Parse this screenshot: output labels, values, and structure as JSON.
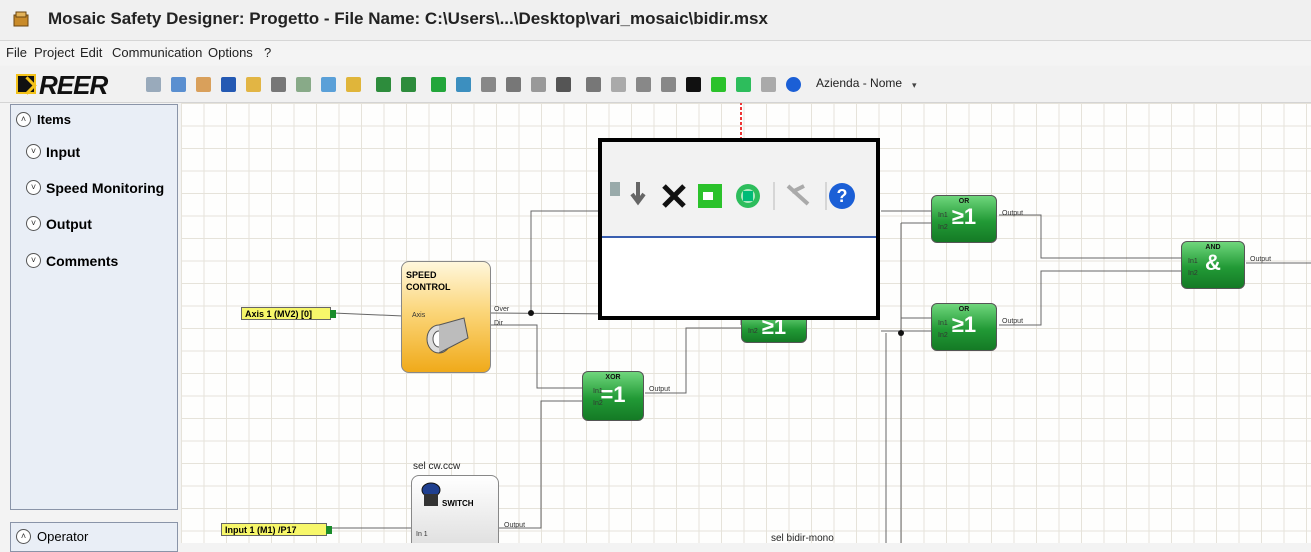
{
  "window": {
    "title": "Mosaic Safety Designer: Progetto  -  File Name: C:\\Users\\...\\Desktop\\vari_mosaic\\bidir.msx"
  },
  "menu": [
    "File",
    "Project",
    "Edit",
    "Communication",
    "Options",
    "?"
  ],
  "toolbar": {
    "logo": "REER",
    "company": "Azienda - Nome",
    "icons": [
      "new-project-icon",
      "open-icon",
      "user-icon",
      "save-icon",
      "folder-icon",
      "print-icon",
      "print-preview-icon",
      "report-icon",
      "pencil-icon",
      "undo-icon",
      "redo-icon",
      "validate-check-icon",
      "compile-icon",
      "connect-icon",
      "monitor-icon",
      "password-icon",
      "upload-icon",
      "zoom-icon",
      "clipboard-icon",
      "download-icon",
      "disconnect-icon",
      "delete-icon",
      "io-test-icon",
      "tool-icon",
      "pin-icon",
      "help-icon"
    ]
  },
  "left_panel": {
    "items_header": "Items",
    "sections": [
      "Input",
      "Speed Monitoring",
      "Output",
      "Comments"
    ],
    "operator_header": "Operator"
  },
  "canvas": {
    "inputs": [
      {
        "label": "Axis 1 (MV2) [0]"
      },
      {
        "label": "Input 1 (M1) /P17"
      }
    ],
    "speed_control": {
      "title_line1": "SPEED",
      "title_line2": "CONTROL",
      "in_port": "Axis",
      "out_port1": "Over",
      "out_port2": "Dir"
    },
    "xor": {
      "type": "XOR",
      "symbol": "=1",
      "in1": "In1",
      "in2": "In2",
      "out": "Output"
    },
    "or_gates": [
      {
        "type": "OR",
        "symbol": "≥1",
        "in1": "In1",
        "in2": "In2",
        "out": "Output"
      },
      {
        "type": "OR",
        "symbol": "≥1",
        "in1": "In1",
        "in2": "In2",
        "out": "Output"
      },
      {
        "type": "",
        "symbol": "≥1",
        "in1": "",
        "in2": "In2",
        "out": ""
      }
    ],
    "and_gate": {
      "type": "AND",
      "symbol": "&",
      "in1": "In1",
      "in2": "In2",
      "out": "Output"
    },
    "switch": {
      "caption": "sel cw.ccw",
      "label": "SWITCH",
      "in": "In 1",
      "out": "Output"
    },
    "bottom_caption": "sel bidir-mono"
  },
  "zoom_callout": {
    "icons": [
      "download-icon",
      "disconnect-icon",
      "delete-icon",
      "io-test-icon",
      "pin-icon",
      "tool-icon",
      "help-icon"
    ]
  }
}
